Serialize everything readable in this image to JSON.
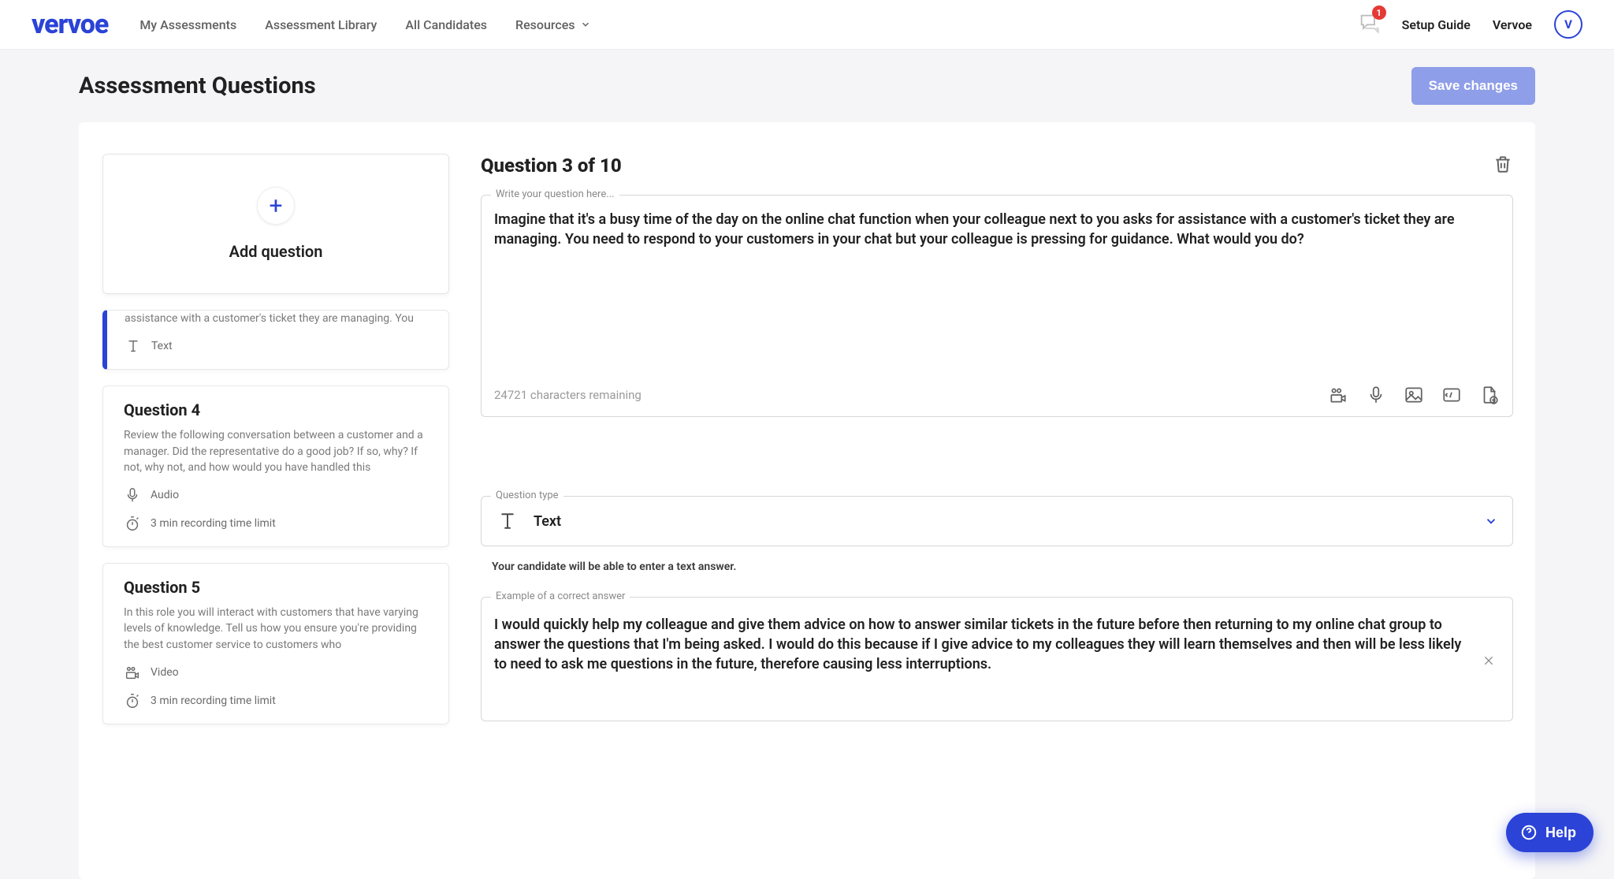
{
  "header": {
    "logo": "vervoe",
    "nav": [
      "My Assessments",
      "Assessment Library",
      "All Candidates",
      "Resources"
    ],
    "notifications": {
      "count": "1"
    },
    "setup_guide": "Setup Guide",
    "user_name": "Vervoe",
    "avatar_initial": "V"
  },
  "page": {
    "title": "Assessment Questions",
    "save_label": "Save changes"
  },
  "sidebar": {
    "add_label": "Add question",
    "selected_partial_desc": "assistance with a customer's ticket they are managing. You",
    "selected_type": "Text",
    "q4": {
      "title": "Question 4",
      "desc": "Review the following conversation between a customer and a manager. Did the representative do a good job? If so, why? If not, why not, and how would you have handled this",
      "type": "Audio",
      "limit": "3 min recording time limit"
    },
    "q5": {
      "title": "Question 5",
      "desc": "In this role you will interact with customers that have varying levels of knowledge. Tell us how you ensure you're providing the best customer service to customers who",
      "type": "Video",
      "limit": "3 min recording time limit"
    }
  },
  "editor": {
    "heading": "Question 3 of 10",
    "question_legend": "Write your question here...",
    "question_text": "Imagine that it's a busy time of the day on the online chat function when your colleague next to you asks for assistance with a customer's ticket they are managing. You need to respond to your customers in your chat but your colleague is pressing for guidance. What would you do?",
    "chars_remaining": "24721 characters remaining",
    "type_legend": "Question type",
    "type_value": "Text",
    "type_helper": "Your candidate will be able to enter a text answer.",
    "answer_legend": "Example of a correct answer",
    "answer_text": "I would quickly help my colleague and give them advice on how to answer similar tickets in the future before then returning to my online chat group to answer the questions that I'm being asked. I would do this because if I give advice to my colleagues they will learn themselves and then will be less likely to need to ask me questions in the future, therefore causing less interruptions."
  },
  "help_label": "Help"
}
